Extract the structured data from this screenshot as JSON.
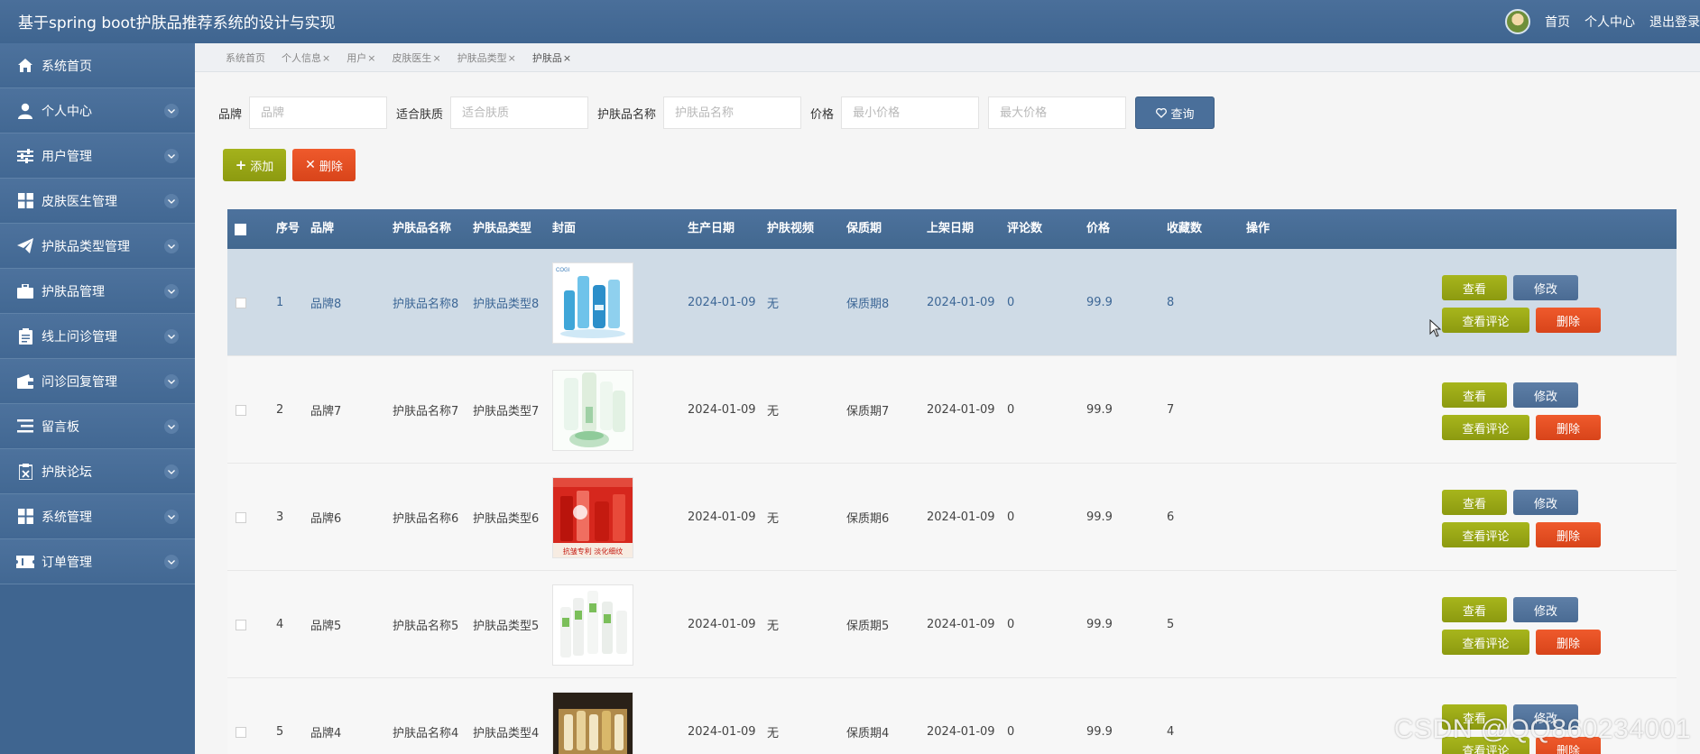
{
  "app": {
    "title": "基于spring boot护肤品推荐系统的设计与实现"
  },
  "topnav": {
    "home": "首页",
    "profile": "个人中心",
    "logout": "退出登录"
  },
  "sidebar": {
    "items": [
      {
        "label": "系统首页",
        "icon": "home-icon"
      },
      {
        "label": "个人中心",
        "icon": "user-icon"
      },
      {
        "label": "用户管理",
        "icon": "sliders-icon"
      },
      {
        "label": "皮肤医生管理",
        "icon": "grid-icon"
      },
      {
        "label": "护肤品类型管理",
        "icon": "paper-plane-icon"
      },
      {
        "label": "护肤品管理",
        "icon": "briefcase-icon"
      },
      {
        "label": "线上问诊管理",
        "icon": "clipboard-icon"
      },
      {
        "label": "问诊回复管理",
        "icon": "wallet-icon"
      },
      {
        "label": "留言板",
        "icon": "list-icon"
      },
      {
        "label": "护肤论坛",
        "icon": "clipboard-x-icon"
      },
      {
        "label": "系统管理",
        "icon": "grid-icon"
      },
      {
        "label": "订单管理",
        "icon": "ticket-icon"
      }
    ]
  },
  "tabs": [
    {
      "label": "系统首页",
      "closable": false
    },
    {
      "label": "个人信息",
      "closable": true
    },
    {
      "label": "用户",
      "closable": true
    },
    {
      "label": "皮肤医生",
      "closable": true
    },
    {
      "label": "护肤品类型",
      "closable": true
    },
    {
      "label": "护肤品",
      "closable": true
    }
  ],
  "tab_close": "×",
  "search": {
    "brand_label": "品牌",
    "brand_placeholder": "品牌",
    "skin_label": "适合肤质",
    "skin_placeholder": "适合肤质",
    "name_label": "护肤品名称",
    "name_placeholder": "护肤品名称",
    "price_label": "价格",
    "min_placeholder": "最小价格",
    "max_placeholder": "最大价格",
    "query_label": "查询"
  },
  "actions": {
    "add_label": "添加",
    "delete_label": "删除"
  },
  "table": {
    "headers": [
      "序号",
      "品牌",
      "护肤品名称",
      "护肤品类型",
      "封面",
      "生产日期",
      "护肤视频",
      "保质期",
      "上架日期",
      "评论数",
      "价格",
      "收藏数",
      "操作"
    ],
    "row_buttons": {
      "view": "查看",
      "edit": "修改",
      "comments": "查看评论",
      "delete": "删除"
    },
    "rows": [
      {
        "no": "1",
        "brand": "品牌8",
        "name": "护肤品名称8",
        "type": "护肤品类型8",
        "date": "2024-01-09",
        "video": "无",
        "shelf": "保质期8",
        "listed": "2024-01-09",
        "comments": "0",
        "price": "99.9",
        "favorites": "8",
        "cover": "blue"
      },
      {
        "no": "2",
        "brand": "品牌7",
        "name": "护肤品名称7",
        "type": "护肤品类型7",
        "date": "2024-01-09",
        "video": "无",
        "shelf": "保质期7",
        "listed": "2024-01-09",
        "comments": "0",
        "price": "99.9",
        "favorites": "7",
        "cover": "green"
      },
      {
        "no": "3",
        "brand": "品牌6",
        "name": "护肤品名称6",
        "type": "护肤品类型6",
        "date": "2024-01-09",
        "video": "无",
        "shelf": "保质期6",
        "listed": "2024-01-09",
        "comments": "0",
        "price": "99.9",
        "favorites": "6",
        "cover": "red"
      },
      {
        "no": "4",
        "brand": "品牌5",
        "name": "护肤品名称5",
        "type": "护肤品类型5",
        "date": "2024-01-09",
        "video": "无",
        "shelf": "保质期5",
        "listed": "2024-01-09",
        "comments": "0",
        "price": "99.9",
        "favorites": "5",
        "cover": "white"
      },
      {
        "no": "5",
        "brand": "品牌4",
        "name": "护肤品名称4",
        "type": "护肤品类型4",
        "date": "2024-01-09",
        "video": "无",
        "shelf": "保质期4",
        "listed": "2024-01-09",
        "comments": "0",
        "price": "99.9",
        "favorites": "4",
        "cover": "gold"
      }
    ]
  },
  "cover_text": {
    "row3": "抗皱专利 淡化细纹",
    "row1_brand": "COGI"
  },
  "watermark": "CSDN @QQ860234001"
}
